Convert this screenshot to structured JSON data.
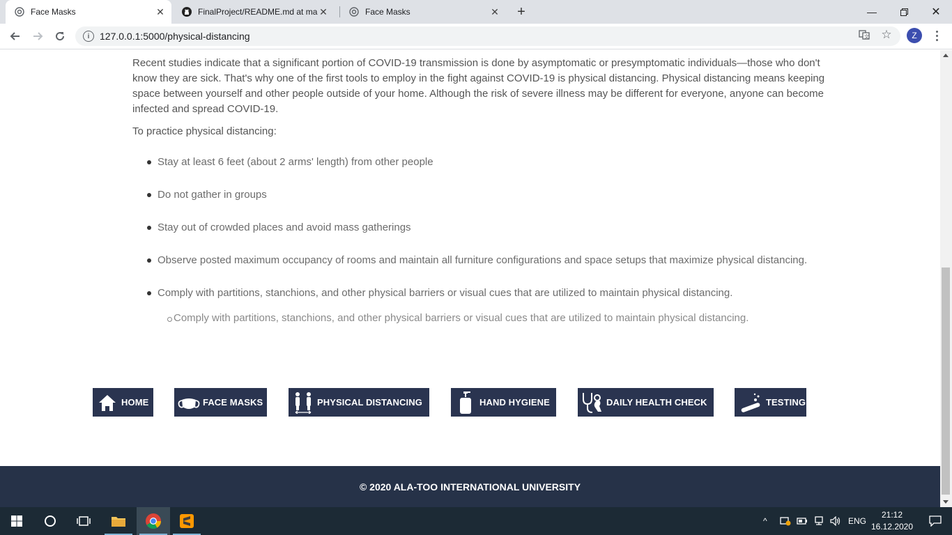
{
  "browser": {
    "tabs": [
      {
        "title": "Face Masks",
        "active": true
      },
      {
        "title": "FinalProject/README.md at main",
        "active": false
      },
      {
        "title": "Face Masks",
        "active": false
      }
    ],
    "url": "127.0.0.1:5000/physical-distancing",
    "profile_initial": "Z"
  },
  "content": {
    "intro": "Recent studies indicate that a significant portion of COVID-19 transmission is done by asymptomatic or presymptomatic individuals—those who don't know they are sick. That's why one of the first tools to employ in the fight against COVID-19 is physical distancing. Physical distancing means keeping space between yourself and other people outside of your home. Although the risk of severe illness may be different for everyone, anyone can become infected and spread COVID-19.",
    "lead": "To practice physical distancing:",
    "items": [
      "Stay at least 6 feet (about 2 arms' length) from other people",
      "Do not gather in groups",
      "Stay out of crowded places and avoid mass gatherings",
      "Observe posted maximum occupancy of rooms and maintain all furniture configurations and space setups that maximize physical distancing.",
      "Comply with partitions, stanchions, and other physical barriers or visual cues that are utilized to maintain physical distancing."
    ],
    "sub_item": "Comply with partitions, stanchions, and other physical barriers or visual cues that are utilized to maintain physical distancing."
  },
  "nav": [
    {
      "label": "HOME",
      "icon": "home-icon"
    },
    {
      "label": "FACE MASKS",
      "icon": "mask-icon"
    },
    {
      "label": "PHYSICAL DISTANCING",
      "icon": "distancing-icon"
    },
    {
      "label": "HAND HYGIENE",
      "icon": "soap-icon"
    },
    {
      "label": "DAILY HEALTH CHECK",
      "icon": "stethoscope-icon"
    },
    {
      "label": "TESTING",
      "icon": "test-tube-icon"
    }
  ],
  "footer": {
    "text": "© 2020 ALA-TOO INTERNATIONAL UNIVERSITY"
  },
  "taskbar": {
    "lang": "ENG",
    "time": "21:12",
    "date": "16.12.2020"
  },
  "colors": {
    "nav_bg": "#2a3450",
    "footer_bg": "#263248",
    "taskbar_bg": "#1c2a35"
  }
}
